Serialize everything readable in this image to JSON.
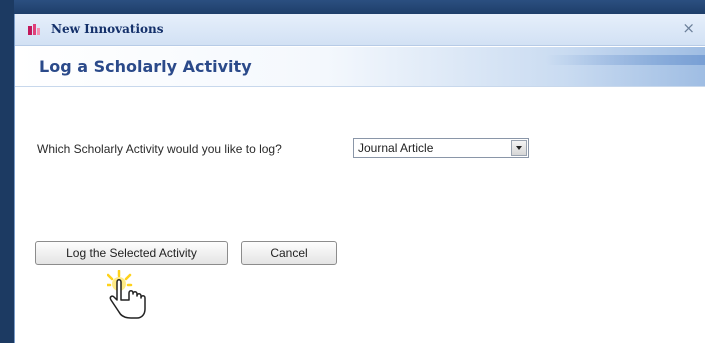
{
  "window": {
    "app_title": "New Innovations",
    "close_glyph": "×"
  },
  "header": {
    "title": "Log a Scholarly Activity"
  },
  "form": {
    "question_label": "Which Scholarly Activity would you like to log?",
    "activity_select": {
      "selected_value": "Journal Article"
    }
  },
  "actions": {
    "log_label": "Log the Selected Activity",
    "cancel_label": "Cancel"
  },
  "icons": {
    "app": "new-innovations-logo-icon",
    "close": "close-icon",
    "dropdown": "chevron-down-icon",
    "cursor": "hand-pointer-icon"
  },
  "colors": {
    "title_text": "#2b4a8a",
    "app_title_text": "#14306a",
    "background": "#1e3e6a",
    "click_highlight": "#ffd21a"
  }
}
